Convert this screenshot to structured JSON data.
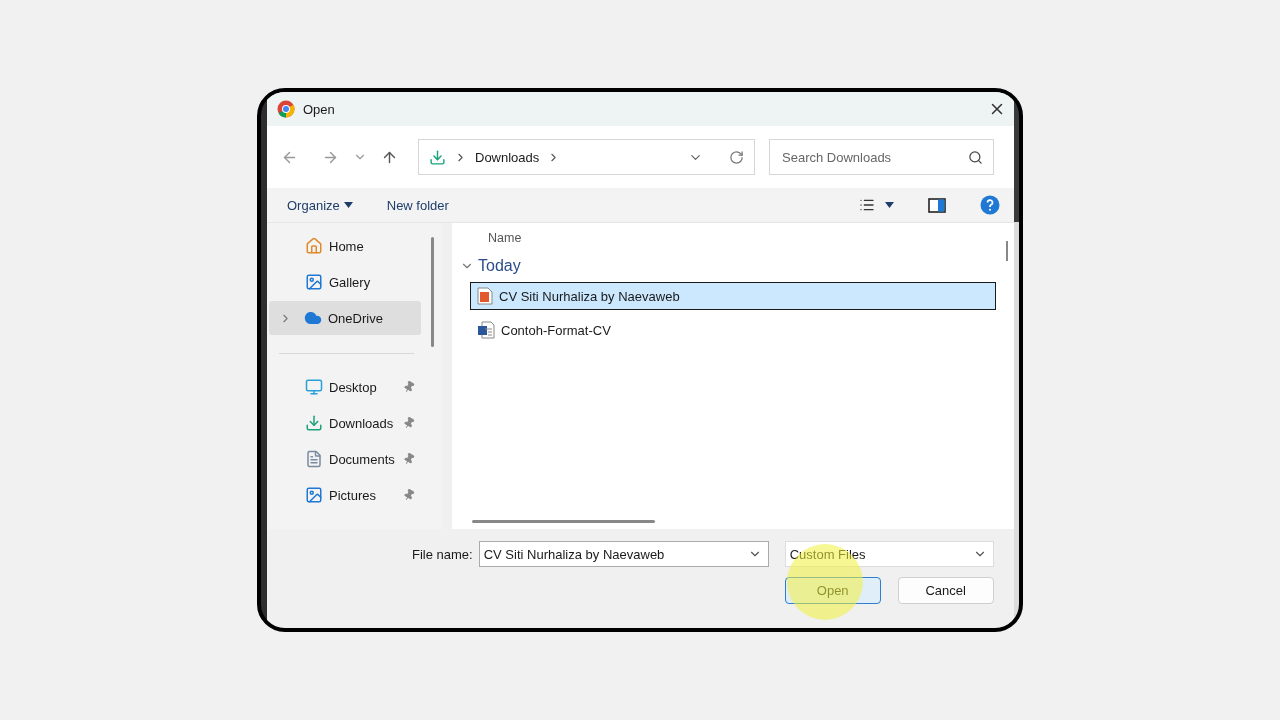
{
  "window": {
    "title": "Open"
  },
  "address": {
    "path": "Downloads"
  },
  "search": {
    "placeholder": "Search Downloads"
  },
  "toolbar": [
    {
      "label": "Organize",
      "kind": "menu"
    },
    {
      "label": "New folder",
      "kind": "button"
    }
  ],
  "sidebar": {
    "items": [
      {
        "label": "Home",
        "kind": "home",
        "selected": false,
        "pinned": false,
        "expandable": false
      },
      {
        "label": "Gallery",
        "kind": "gallery",
        "selected": false,
        "pinned": false,
        "expandable": false
      },
      {
        "label": "OneDrive",
        "kind": "cloud",
        "selected": true,
        "pinned": false,
        "expandable": true
      },
      {
        "label": "Desktop",
        "kind": "desktop",
        "selected": false,
        "pinned": true,
        "expandable": false
      },
      {
        "label": "Downloads",
        "kind": "download",
        "selected": false,
        "pinned": true,
        "expandable": false
      },
      {
        "label": "Documents",
        "kind": "document",
        "selected": false,
        "pinned": true,
        "expandable": false
      },
      {
        "label": "Pictures",
        "kind": "pictures",
        "selected": false,
        "pinned": true,
        "expandable": false
      }
    ]
  },
  "file_list": {
    "columns": [
      "Name"
    ],
    "groups": [
      {
        "label": "Today",
        "expanded": true,
        "items": [
          {
            "name": "CV Siti Nurhaliza by Naevaweb",
            "kind": "pdf",
            "selected": true
          },
          {
            "name": "Contoh-Format-CV",
            "kind": "word",
            "selected": false
          }
        ]
      }
    ]
  },
  "footer": {
    "file_name_label": "File name:",
    "file_name": "CV Siti Nurhaliza by Naevaweb",
    "file_type": "Custom Files",
    "buttons": [
      {
        "label": "Open",
        "kind": "primary"
      },
      {
        "label": "Cancel",
        "kind": "secondary"
      }
    ]
  }
}
